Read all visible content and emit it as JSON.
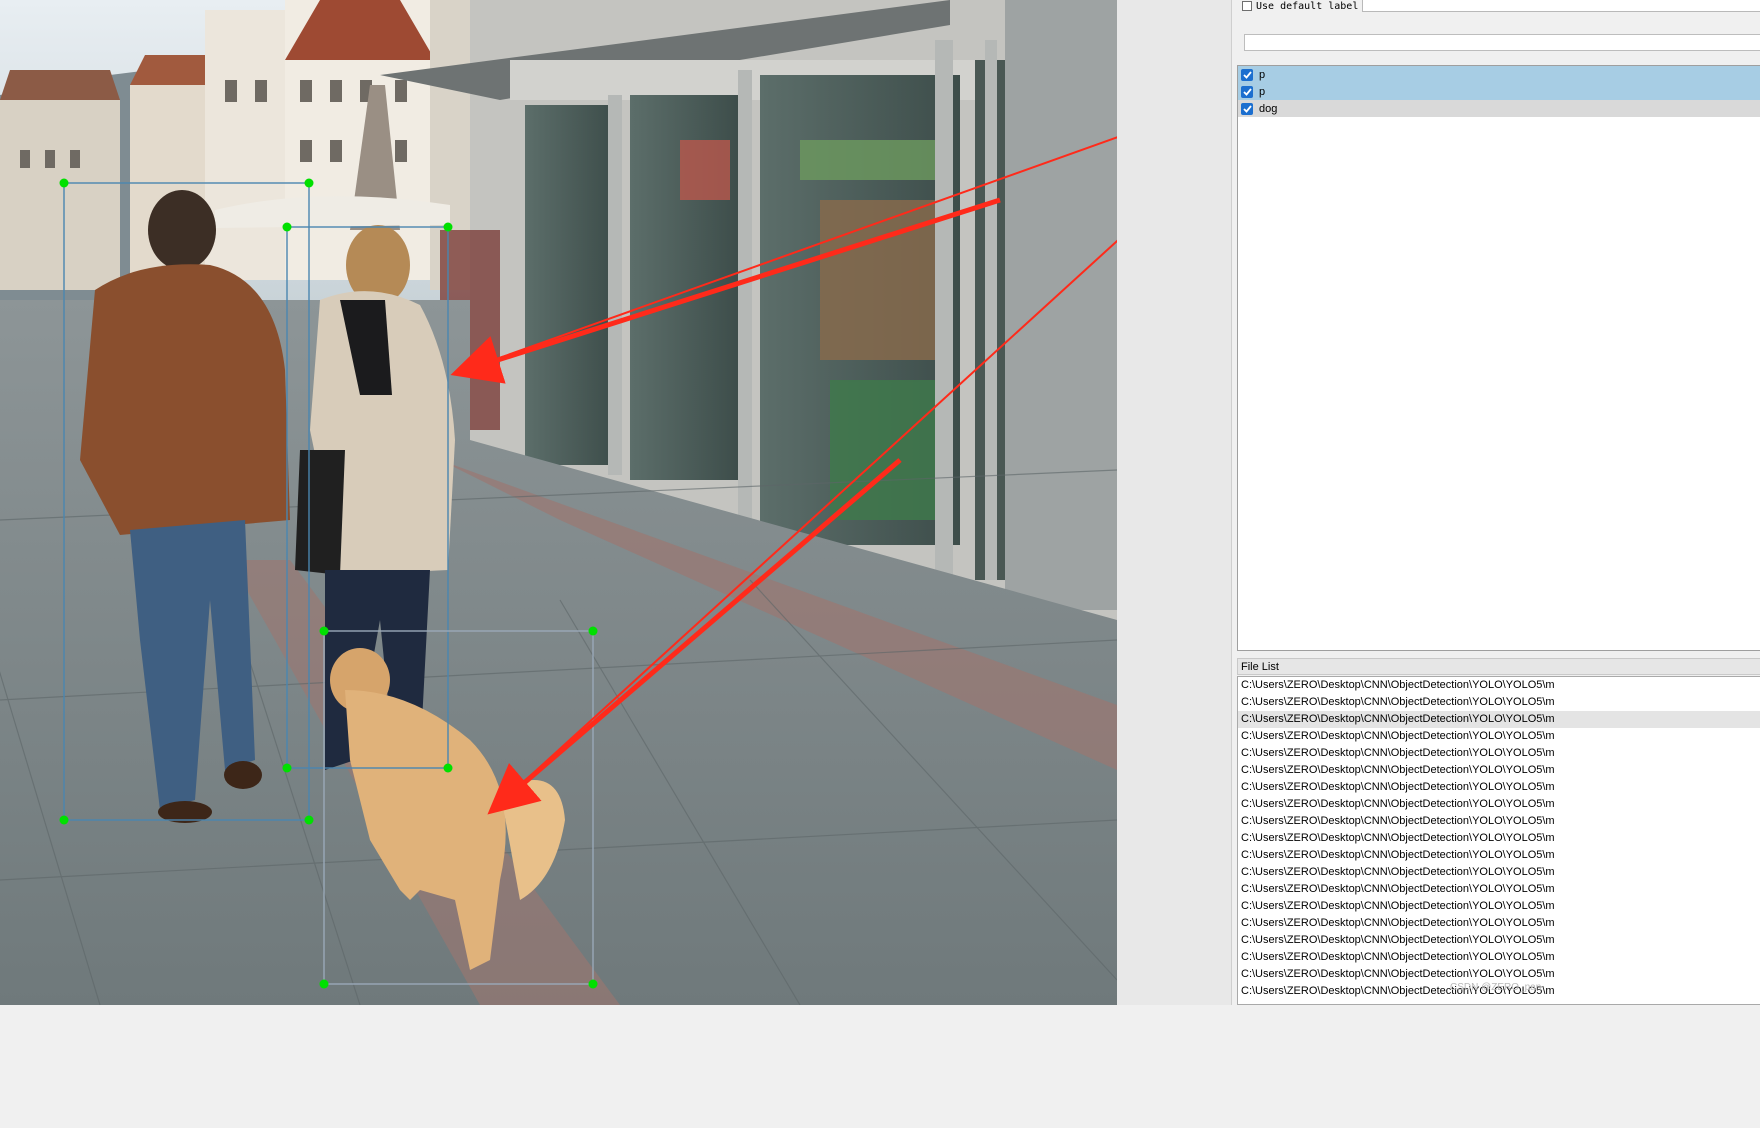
{
  "toolbar": {
    "use_default_label_text": "Use default label",
    "use_default_label_checked": false,
    "default_label_value": "",
    "filter_value": ""
  },
  "labels": [
    {
      "text": "p",
      "checked": true,
      "selected": true
    },
    {
      "text": "p",
      "checked": true,
      "selected": true
    },
    {
      "text": "dog",
      "checked": true,
      "selected": false
    }
  ],
  "file_list": {
    "title": "File List",
    "items": [
      "C:\\Users\\ZERO\\Desktop\\CNN\\ObjectDetection\\YOLO\\YOLO5\\m",
      "C:\\Users\\ZERO\\Desktop\\CNN\\ObjectDetection\\YOLO\\YOLO5\\m",
      "C:\\Users\\ZERO\\Desktop\\CNN\\ObjectDetection\\YOLO\\YOLO5\\m",
      "C:\\Users\\ZERO\\Desktop\\CNN\\ObjectDetection\\YOLO\\YOLO5\\m",
      "C:\\Users\\ZERO\\Desktop\\CNN\\ObjectDetection\\YOLO\\YOLO5\\m",
      "C:\\Users\\ZERO\\Desktop\\CNN\\ObjectDetection\\YOLO\\YOLO5\\m",
      "C:\\Users\\ZERO\\Desktop\\CNN\\ObjectDetection\\YOLO\\YOLO5\\m",
      "C:\\Users\\ZERO\\Desktop\\CNN\\ObjectDetection\\YOLO\\YOLO5\\m",
      "C:\\Users\\ZERO\\Desktop\\CNN\\ObjectDetection\\YOLO\\YOLO5\\m",
      "C:\\Users\\ZERO\\Desktop\\CNN\\ObjectDetection\\YOLO\\YOLO5\\m",
      "C:\\Users\\ZERO\\Desktop\\CNN\\ObjectDetection\\YOLO\\YOLO5\\m",
      "C:\\Users\\ZERO\\Desktop\\CNN\\ObjectDetection\\YOLO\\YOLO5\\m",
      "C:\\Users\\ZERO\\Desktop\\CNN\\ObjectDetection\\YOLO\\YOLO5\\m",
      "C:\\Users\\ZERO\\Desktop\\CNN\\ObjectDetection\\YOLO\\YOLO5\\m",
      "C:\\Users\\ZERO\\Desktop\\CNN\\ObjectDetection\\YOLO\\YOLO5\\m",
      "C:\\Users\\ZERO\\Desktop\\CNN\\ObjectDetection\\YOLO\\YOLO5\\m",
      "C:\\Users\\ZERO\\Desktop\\CNN\\ObjectDetection\\YOLO\\YOLO5\\m",
      "C:\\Users\\ZERO\\Desktop\\CNN\\ObjectDetection\\YOLO\\YOLO5\\m",
      "C:\\Users\\ZERO\\Desktop\\CNN\\ObjectDetection\\YOLO\\YOLO5\\m"
    ],
    "current_index": 2
  },
  "canvas": {
    "box_color": "#4a86b0",
    "handle_color": "#00e000",
    "arrow_color": "#ff2a1a"
  },
  "colors": {
    "selected_row": "#a7cde4",
    "checkbox": "#1c6fcf"
  }
}
